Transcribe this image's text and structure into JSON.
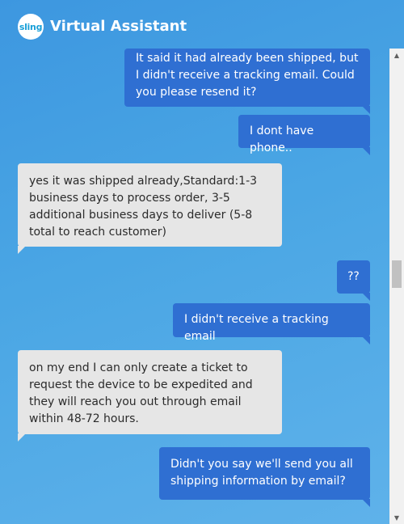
{
  "header": {
    "logo_text": "sling",
    "title": "Virtual Assistant"
  },
  "messages": [
    {
      "role": "user",
      "text": "It said it had already been shipped, but I didn't receive a tracking email. Could you please resend it?"
    },
    {
      "role": "user",
      "text": "I dont have phone.."
    },
    {
      "role": "agent",
      "text": "yes it was shipped already,Standard:1-3 business days to process order, 3-5 additional business days to deliver (5-8 total to reach customer)"
    },
    {
      "role": "user",
      "text": "??"
    },
    {
      "role": "user",
      "text": "I didn't receive a tracking email"
    },
    {
      "role": "agent",
      "text": "on my end I can only create a ticket to request the device to be expedited and they will reach you out through email within 48-72 hours."
    },
    {
      "role": "user",
      "text": "Didn't you say we'll send you all shipping information by email?"
    }
  ],
  "scrollbar": {
    "up_icon": "triangle-up",
    "down_icon": "triangle-down"
  },
  "colors": {
    "user_bubble": "#2f6fd2",
    "agent_bubble": "#e6e6e6",
    "background": "#4aa6e4"
  }
}
